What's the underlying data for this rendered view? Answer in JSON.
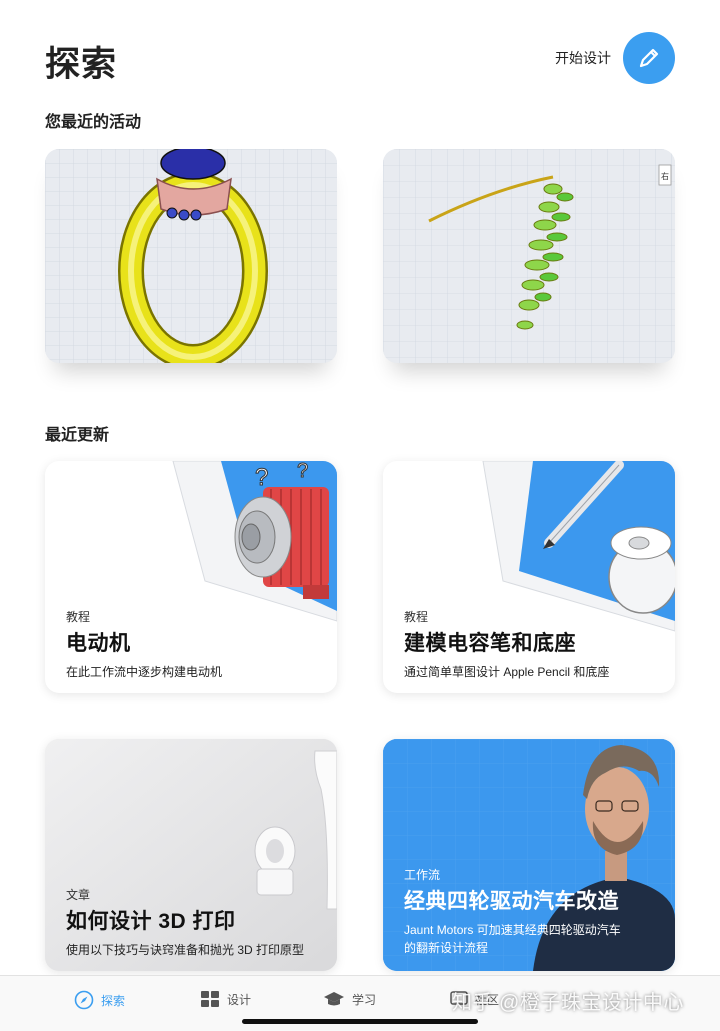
{
  "header": {
    "title": "探索",
    "start_design_label": "开始设计",
    "pen_icon": "pen-icon"
  },
  "recent": {
    "heading": "您最近的活动",
    "items": [
      {
        "thumbnail": "ring-3d-model"
      },
      {
        "thumbnail": "leaf-branch-3d-model",
        "view_cube_label": "右"
      }
    ]
  },
  "updates": {
    "heading": "最近更新",
    "cards": [
      {
        "category": "教程",
        "title": "电动机",
        "description": "在此工作流中逐步构建电动机"
      },
      {
        "category": "教程",
        "title": "建模电容笔和底座",
        "description": "通过简单草图设计 Apple Pencil 和底座"
      },
      {
        "category": "文章",
        "title": "如何设计 3D 打印",
        "description": "使用以下技巧与诀窍准备和抛光 3D 打印原型"
      },
      {
        "category": "工作流",
        "title": "经典四轮驱动汽车改造",
        "description": "Jaunt Motors 可加速其经典四轮驱动汽车的翻新设计流程"
      }
    ]
  },
  "tabbar": {
    "tabs": [
      {
        "label": "探索",
        "icon": "compass-icon",
        "active": true
      },
      {
        "label": "设计",
        "icon": "grid-icon",
        "active": false
      },
      {
        "label": "学习",
        "icon": "graduation-cap-icon",
        "active": false
      },
      {
        "label": "社区",
        "icon": "community-icon",
        "active": false
      }
    ]
  },
  "watermark": "知乎 @橙子珠宝设计中心",
  "colors": {
    "accent": "#3b9ef0",
    "workflow_card": "#3c98ee"
  }
}
